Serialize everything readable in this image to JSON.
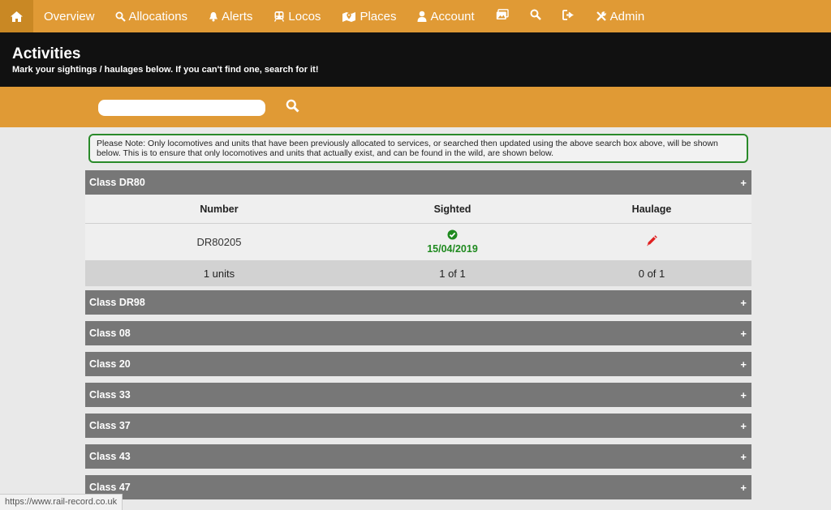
{
  "nav": {
    "items": [
      {
        "label": "Overview"
      },
      {
        "label": "Allocations"
      },
      {
        "label": "Alerts"
      },
      {
        "label": "Locos"
      },
      {
        "label": "Places"
      },
      {
        "label": "Account"
      },
      {
        "label": "Admin"
      }
    ]
  },
  "header": {
    "title": "Activities",
    "subtitle": "Mark your sightings / haulages below. If you can't find one, search for it!"
  },
  "search": {
    "value": "",
    "placeholder": ""
  },
  "note": "Please Note: Only locomotives and units that have been previously allocated to services, or searched then updated using the above search box above, will be shown below. This is to ensure that only locomotives and units that actually exist, and can be found in the wild, are shown below.",
  "expanded_class": {
    "name": "Class DR80",
    "toggle": "+",
    "columns": [
      "Number",
      "Sighted",
      "Haulage"
    ],
    "rows": [
      {
        "number": "DR80205",
        "sighted_date": "15/04/2019"
      }
    ],
    "footer": {
      "units": "1 units",
      "sighted": "1 of 1",
      "haulage": "0 of 1"
    }
  },
  "classes": [
    {
      "name": "Class DR98",
      "toggle": "+"
    },
    {
      "name": "Class 08",
      "toggle": "+"
    },
    {
      "name": "Class 20",
      "toggle": "+"
    },
    {
      "name": "Class 33",
      "toggle": "+"
    },
    {
      "name": "Class 37",
      "toggle": "+"
    },
    {
      "name": "Class 43",
      "toggle": "+"
    },
    {
      "name": "Class 47",
      "toggle": "+"
    }
  ],
  "status_url": "https://www.rail-record.co.uk",
  "colors": {
    "nav_bg": "#e09a35",
    "header_bg": "#111111",
    "sighted_green": "#1f8a1f",
    "haulage_red": "#e02020"
  }
}
